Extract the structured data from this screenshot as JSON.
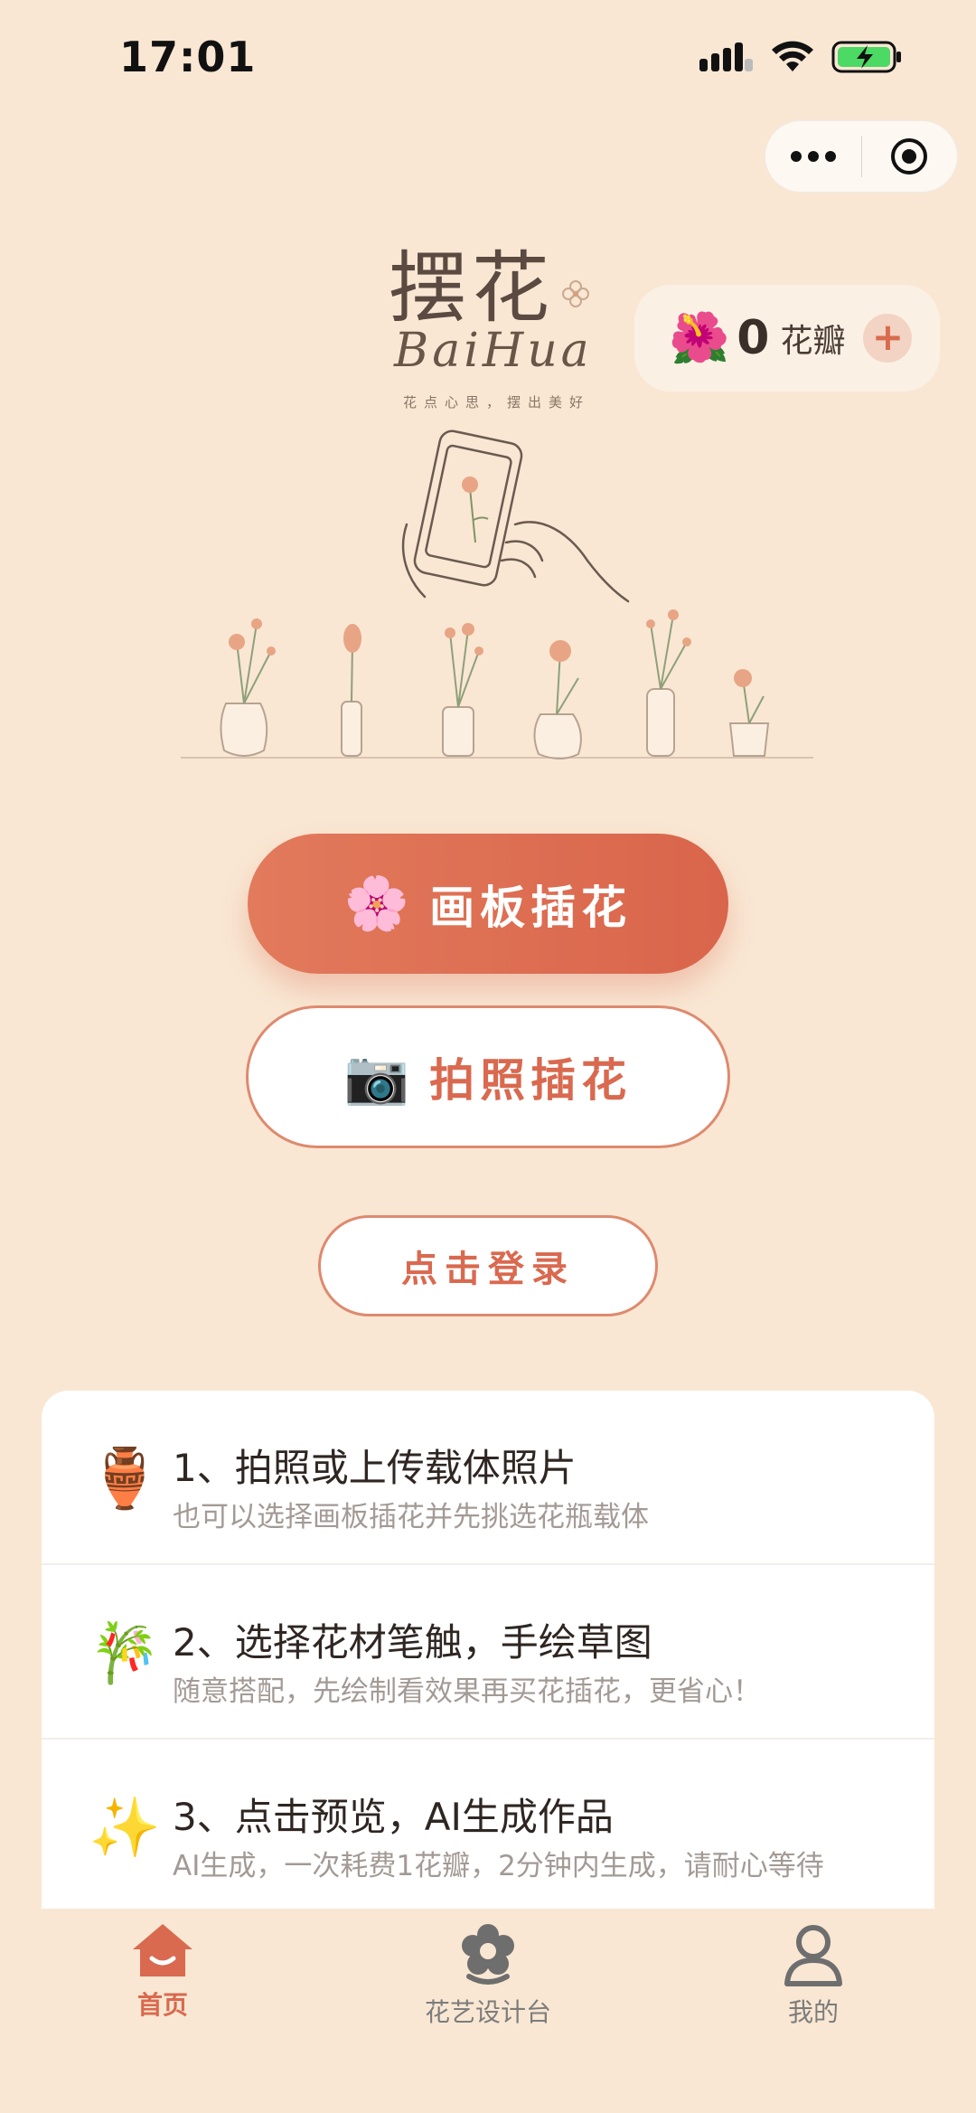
{
  "status": {
    "time": "17:01"
  },
  "petals": {
    "count": "0",
    "label": "花瓣",
    "plus": "+",
    "flower_emoji": "🌺"
  },
  "logo": {
    "title": "摆花",
    "english": "BaiHua",
    "tagline": "花点心思，摆出美好"
  },
  "buttons": {
    "canvas": {
      "emoji": "🌸",
      "label": "画板插花"
    },
    "photo": {
      "emoji": "📷",
      "label": "拍照插花"
    },
    "login": {
      "label": "点击登录"
    }
  },
  "steps": [
    {
      "icon": "🏺",
      "title": "1、拍照或上传载体照片",
      "desc": "也可以选择画板插花并先挑选花瓶载体"
    },
    {
      "icon": "🎋",
      "title": "2、选择花材笔触，手绘草图",
      "desc": "随意搭配，先绘制看效果再买花插花，更省心！"
    },
    {
      "icon": "✨",
      "title": "3、点击预览，AI生成作品",
      "desc": "AI生成，一次耗费1花瓣，2分钟内生成，请耐心等待"
    }
  ],
  "tabs": [
    {
      "label": "首页",
      "active": true,
      "color": "#d9694f"
    },
    {
      "label": "花艺设计台",
      "active": false,
      "color": "#7c7c7c"
    },
    {
      "label": "我的",
      "active": false,
      "color": "#7c7c7c"
    }
  ],
  "colors": {
    "background": "#f9e7d3",
    "accent": "#d9694f"
  }
}
